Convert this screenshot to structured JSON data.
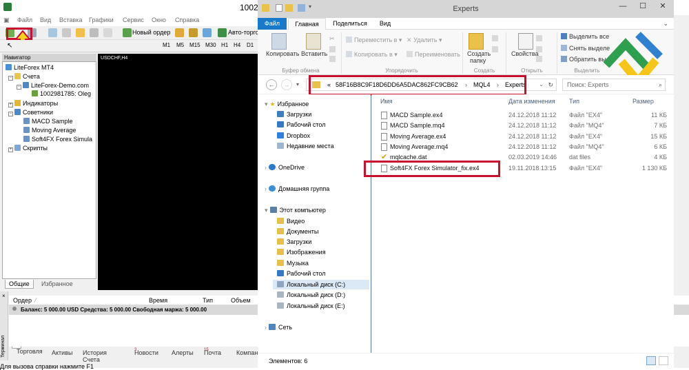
{
  "mt4": {
    "title": "1002",
    "menu": [
      "Файл",
      "Вид",
      "Вставка",
      "Графики",
      "Сервис",
      "Окно",
      "Справка"
    ],
    "toolbar": {
      "new_order": "Новый ордер",
      "autotrading": "Авто-торго"
    },
    "timeframes": [
      "M1",
      "M5",
      "M15",
      "M30",
      "H1",
      "H4",
      "D1"
    ],
    "navigator": {
      "header": "Навигатор",
      "root": "LiteForex MT4",
      "accounts": "Счета",
      "server": "LiteForex-Demo.com",
      "account": "1002981785: Oleg",
      "indicators": "Индикаторы",
      "advisors": "Советники",
      "experts": [
        "MACD Sample",
        "Moving Average",
        "Soft4FX Forex Simula"
      ],
      "scripts": "Скрипты",
      "tabs": [
        "Общие",
        "Избранное"
      ]
    },
    "chart_label": "USDCHF,H4",
    "terminal": {
      "side_label": "Терминал",
      "columns": [
        "Ордер",
        "Время",
        "Тип",
        "Объем"
      ],
      "balance": "Баланс: 5 000.00 USD  Средства: 5 000.00  Свободная маржа: 5 000.00",
      "tabs": [
        {
          "label": "Торговля",
          "badge": ""
        },
        {
          "label": "Активы",
          "badge": ""
        },
        {
          "label": "История Счета",
          "badge": ""
        },
        {
          "label": "Новости",
          "badge": "3"
        },
        {
          "label": "Алерты",
          "badge": ""
        },
        {
          "label": "Почта",
          "badge": "15"
        },
        {
          "label": "Компан",
          "badge": ""
        }
      ]
    },
    "status": "Для вызова справки нажмите F1"
  },
  "explorer": {
    "title": "Experts",
    "ribbon_tabs": [
      "Файл",
      "Главная",
      "Поделиться",
      "Вид"
    ],
    "ribbon": {
      "copy": "Копировать",
      "paste": "Вставить",
      "clipboard_group": "Буфер обмена",
      "move_to": "Переместить в",
      "copy_to": "Копировать в",
      "delete": "Удалить",
      "rename": "Переименовать",
      "organize_group": "Упорядочить",
      "new_folder": "Создать",
      "new_folder2": "папку",
      "create_group": "Создать",
      "properties": "Свойства",
      "open_group": "Открыть",
      "select_all": "Выделить все",
      "deselect": "Снять выделе",
      "invert": "Обратить вы",
      "select_group": "Выделить"
    },
    "address": {
      "prefix": "«",
      "segments": [
        "58F16B8C9F18D6DD6A5DAC862FC9CB62",
        "MQL4",
        "Experts"
      ]
    },
    "search_placeholder": "Поиск: Experts",
    "nav": {
      "favorites": "Избранное",
      "fav_items": [
        "Загрузки",
        "Рабочий стол",
        "Dropbox",
        "Недавние места"
      ],
      "onedrive": "OneDrive",
      "homegroup": "Домашняя группа",
      "computer": "Этот компьютер",
      "pc_items": [
        "Видео",
        "Документы",
        "Загрузки",
        "Изображения",
        "Музыка",
        "Рабочий стол"
      ],
      "drives": [
        "Локальный диск (C:)",
        "Локальный диск (D:)",
        "Локальный диск (E:)"
      ],
      "network": "Сеть"
    },
    "columns": [
      "Имя",
      "Дата изменения",
      "Тип",
      "Размер"
    ],
    "files": [
      {
        "name": "MACD Sample.ex4",
        "date": "24.12.2018 11:12",
        "type": "Файл \"EX4\"",
        "size": "11 КБ"
      },
      {
        "name": "MACD Sample.mq4",
        "date": "24.12.2018 11:12",
        "type": "Файл \"MQ4\"",
        "size": "7 КБ"
      },
      {
        "name": "Moving Average.ex4",
        "date": "24.12.2018 11:12",
        "type": "Файл \"EX4\"",
        "size": "15 КБ"
      },
      {
        "name": "Moving Average.mq4",
        "date": "24.12.2018 11:12",
        "type": "Файл \"MQ4\"",
        "size": "6 КБ"
      },
      {
        "name": "mqlcache.dat",
        "date": "02.03.2019 14:46",
        "type": "dat files",
        "size": "4 КБ"
      },
      {
        "name": "Soft4FX Forex Simulator_fix.ex4",
        "date": "19.11.2018 13:15",
        "type": "Файл \"EX4\"",
        "size": "1 130 КБ"
      }
    ],
    "status": "Элементов: 6"
  },
  "colors": {
    "highlight": "#c8102e",
    "file_tab": "#1979ca",
    "logo_green": "#2e9e4f",
    "logo_yellow": "#f5c518",
    "logo_blue": "#2f80d1"
  }
}
